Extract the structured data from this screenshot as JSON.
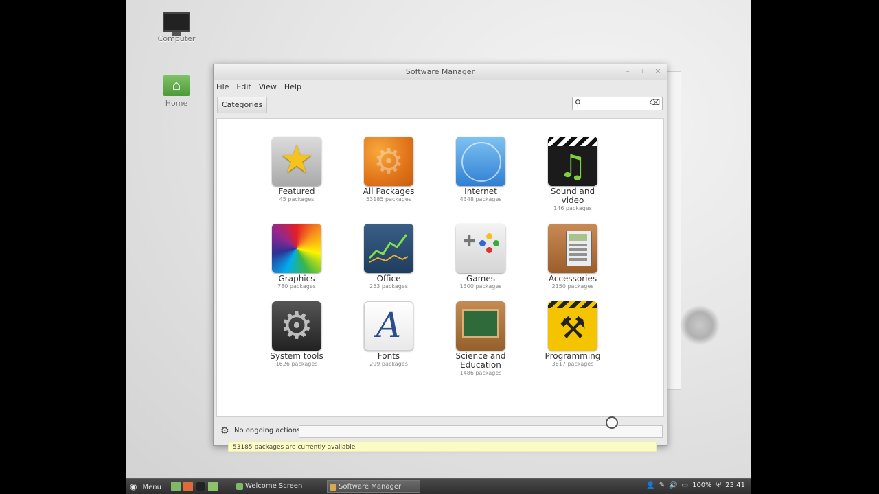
{
  "desktop": {
    "icons": [
      {
        "label": "Computer"
      },
      {
        "label": "Home"
      }
    ]
  },
  "window": {
    "title": "Software Manager",
    "controls": {
      "minimize": "–",
      "maximize": "+",
      "close": "×"
    },
    "menu": [
      "File",
      "Edit",
      "View",
      "Help"
    ],
    "categories_button": "Categories",
    "search": {
      "value": "",
      "placeholder": ""
    },
    "categories": [
      {
        "name": "Featured",
        "count": "45 packages",
        "icon": "star-icon"
      },
      {
        "name": "All Packages",
        "count": "53185 packages",
        "icon": "gears-icon"
      },
      {
        "name": "Internet",
        "count": "4348 packages",
        "icon": "globe-icon"
      },
      {
        "name": "Sound and video",
        "name_lines": [
          "Sound and",
          "video"
        ],
        "count": "146 packages",
        "icon": "music-icon"
      },
      {
        "name": "Graphics",
        "count": "780 packages",
        "icon": "color-wheel-icon"
      },
      {
        "name": "Office",
        "count": "253 packages",
        "icon": "chart-icon"
      },
      {
        "name": "Games",
        "count": "1300 packages",
        "icon": "gamepad-icon"
      },
      {
        "name": "Accessories",
        "count": "2150 packages",
        "icon": "calculator-icon"
      },
      {
        "name": "System tools",
        "count": "1626 packages",
        "icon": "gear-icon"
      },
      {
        "name": "Fonts",
        "count": "299 packages",
        "icon": "font-icon"
      },
      {
        "name": "Science and Education",
        "name_lines": [
          "Science and",
          "Education"
        ],
        "count": "1486 packages",
        "icon": "chalkboard-icon"
      },
      {
        "name": "Programming",
        "count": "3617 packages",
        "icon": "construction-icon"
      }
    ],
    "status": "53185 packages are currently available",
    "actions": "No ongoing actions"
  },
  "taskbar": {
    "menu_label": "Menu",
    "tasks": [
      "Welcome Screen",
      "Software Manager"
    ],
    "battery": "100%",
    "clock": "23:41"
  }
}
